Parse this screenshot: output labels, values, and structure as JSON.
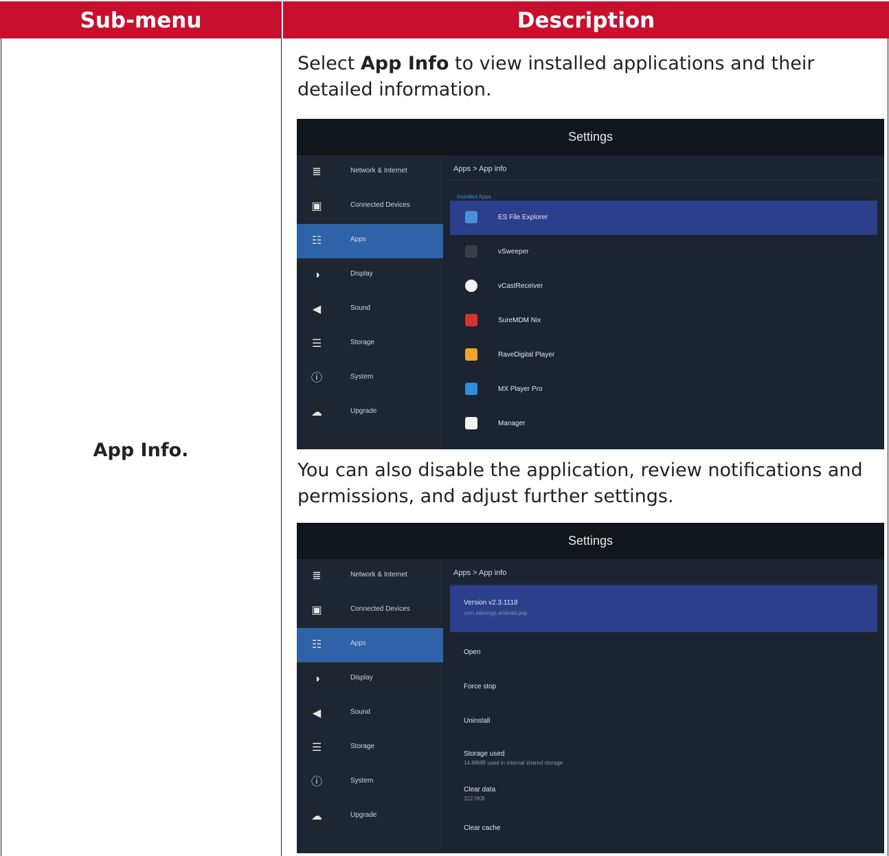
{
  "table": {
    "header": {
      "col1": "Sub-menu",
      "col2": "Description"
    },
    "submenu": "App Info.",
    "para1_pre": "Select ",
    "para1_bold": "App Info",
    "para1_post": " to view installed applications and their detailed information.",
    "para2": "You can also disable the application, review notifications and permissions, and adjust further settings."
  },
  "colors": {
    "header_bg": "#c8102e",
    "active_item": "#2e63a8",
    "selected_row": "#2b3f8c"
  },
  "screen1": {
    "title": "Settings",
    "breadcrumb": "Apps > App info",
    "section": "Installed Apps",
    "sidebar": [
      {
        "label": "Network & Internet",
        "icon": "wifi-icon"
      },
      {
        "label": "Connected Devices",
        "icon": "devices-icon"
      },
      {
        "label": "Apps",
        "icon": "apps-grid-icon",
        "active": true
      },
      {
        "label": "Display",
        "icon": "display-icon"
      },
      {
        "label": "Sound",
        "icon": "speaker-icon"
      },
      {
        "label": "Storage",
        "icon": "storage-icon"
      },
      {
        "label": "System",
        "icon": "system-icon"
      },
      {
        "label": "Upgrade",
        "icon": "cloud-upload-icon"
      }
    ],
    "apps": [
      {
        "label": "ES File Explorer",
        "icon": "es-file-explorer-icon",
        "color": "#4a8fd8",
        "selected": true
      },
      {
        "label": "vSweeper",
        "icon": "vsweeper-icon",
        "color": "#3a3f46"
      },
      {
        "label": "vCastReceiver",
        "icon": "vcast-receiver-icon",
        "color": "#f2f2f2"
      },
      {
        "label": "SureMDM Nix",
        "icon": "suremdm-icon",
        "color": "#d4352f"
      },
      {
        "label": "RaveDigital Player",
        "icon": "ravedigital-icon",
        "color": "#f0a431"
      },
      {
        "label": "MX Player Pro",
        "icon": "mx-player-icon",
        "color": "#2f8ee0"
      },
      {
        "label": "Manager",
        "icon": "manager-icon",
        "color": "#f3f3f3"
      }
    ]
  },
  "screen2": {
    "title": "Settings",
    "breadcrumb": "Apps > App info",
    "sidebar": [
      {
        "label": "Network & Internet",
        "icon": "wifi-icon"
      },
      {
        "label": "Connected Devices",
        "icon": "devices-icon"
      },
      {
        "label": "Apps",
        "icon": "apps-grid-icon",
        "active": true
      },
      {
        "label": "Display",
        "icon": "display-icon"
      },
      {
        "label": "Sound",
        "icon": "speaker-icon"
      },
      {
        "label": "Storage",
        "icon": "storage-icon"
      },
      {
        "label": "System",
        "icon": "system-icon"
      },
      {
        "label": "Upgrade",
        "icon": "cloud-upload-icon"
      }
    ],
    "options": [
      {
        "label": "Version v2.3.1118",
        "sub": "com.estrongs.android.pop",
        "selected": true
      },
      {
        "label": "Open",
        "sub": ""
      },
      {
        "label": "Force stop",
        "sub": ""
      },
      {
        "label": "Uninstall",
        "sub": ""
      },
      {
        "label": "Storage used",
        "sub": "14.88MB used in internal shared storage"
      },
      {
        "label": "Clear data",
        "sub": "312.0KB"
      },
      {
        "label": "Clear cache",
        "sub": ""
      }
    ]
  }
}
